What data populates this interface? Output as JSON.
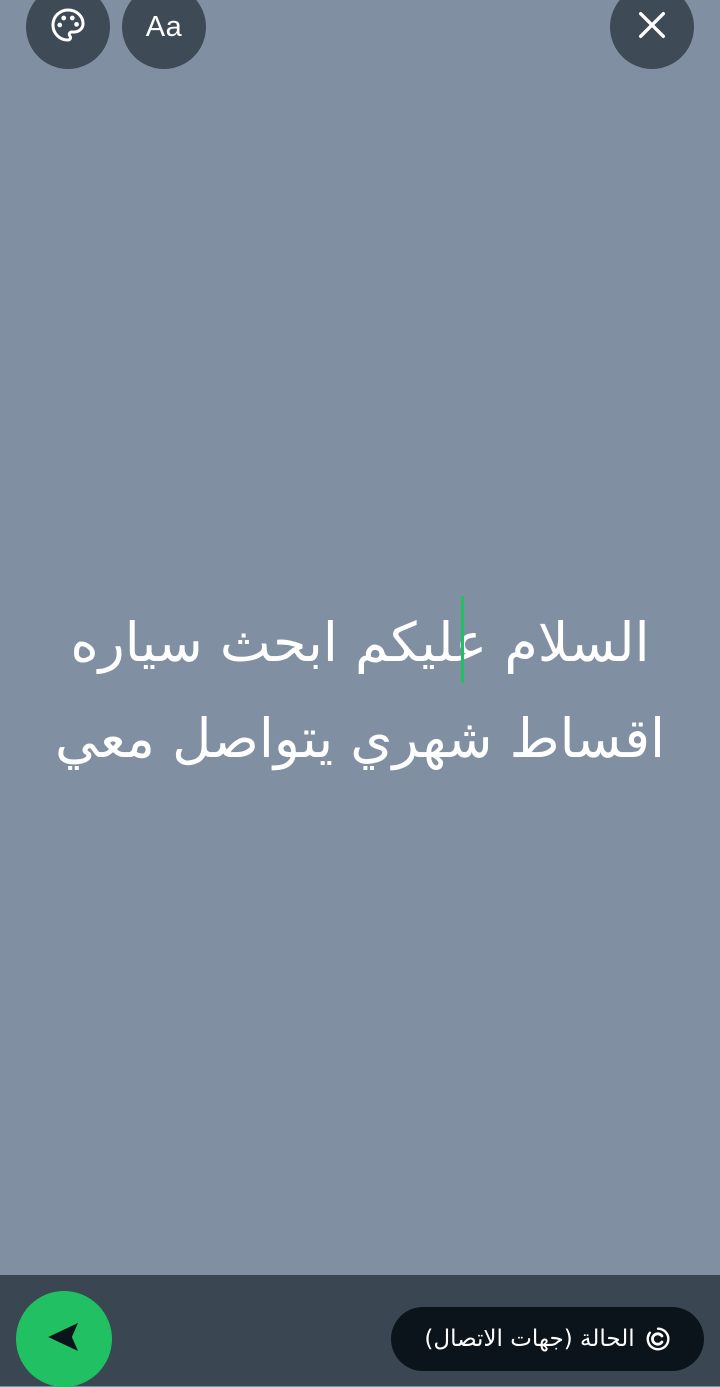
{
  "toolbar": {
    "palette_icon": "palette-icon",
    "font_label": "Aa",
    "close_icon": "close-icon"
  },
  "editor": {
    "text_line_1": "السلام عليكم ابحث سياره",
    "text_line_2": "اقساط شهري يتواصل معي",
    "background_color": "#8090a2",
    "text_color": "#ffffff",
    "caret_color": "#21c063"
  },
  "bottom_bar": {
    "audience_label": "الحالة (جهات الاتصال)",
    "audience_icon": "status-icon",
    "send_icon": "send-arrow-icon",
    "accent_color": "#21c063"
  }
}
